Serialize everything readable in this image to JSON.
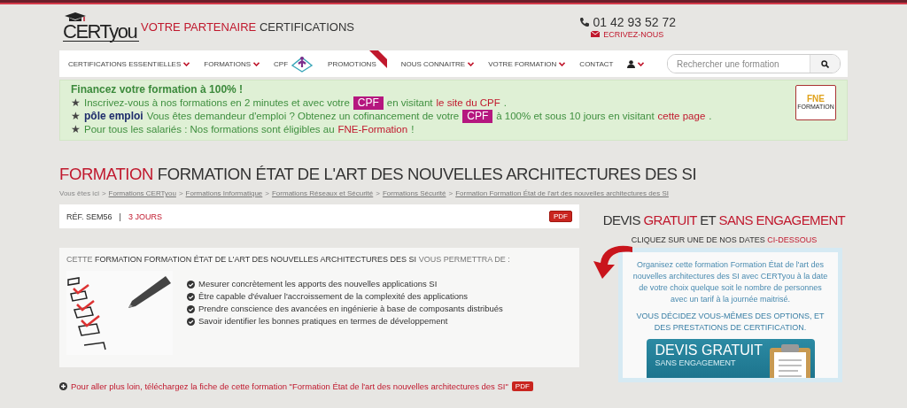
{
  "header": {
    "logo": "CERTyou",
    "tagline": [
      {
        "text": "VOTRE PARTENAIRE",
        "accent": true
      },
      {
        "text": " CERTIFICATIONS",
        "accent": false
      }
    ],
    "phone": "01 42 93 52 72",
    "contact_link": "ECRIVEZ-NOUS"
  },
  "nav": {
    "items": [
      {
        "kind": "text",
        "label": "CERTIFICATIONS ESSENTIELLES",
        "dropdown": true
      },
      {
        "kind": "text",
        "label": "FORMATIONS",
        "dropdown": true
      },
      {
        "kind": "cpf",
        "label": "CPF",
        "dropdown": false
      },
      {
        "kind": "promo",
        "label": "PROMOTIONS",
        "dropdown": false
      },
      {
        "kind": "text",
        "label": "NOUS CONNAITRE",
        "dropdown": true
      },
      {
        "kind": "text",
        "label": "VOTRE FORMATION",
        "dropdown": true
      },
      {
        "kind": "text",
        "label": "CONTACT",
        "dropdown": false
      },
      {
        "kind": "user",
        "dropdown": true
      }
    ],
    "search": {
      "placeholder": "Rechercher une formation"
    }
  },
  "banner": {
    "heading": "Financez votre formation à 100% !",
    "lines": [
      {
        "bullet": "★",
        "segments": [
          {
            "kind": "text",
            "text": "Inscrivez-vous à nos formations en 2 minutes et avec votre"
          },
          {
            "kind": "badge",
            "text": "CPF"
          },
          {
            "kind": "text",
            "text": "en visitant"
          },
          {
            "kind": "link",
            "text": "le site du CPF"
          },
          {
            "kind": "text",
            "text": "."
          }
        ]
      },
      {
        "bullet": "★",
        "segments": [
          {
            "kind": "logo",
            "text": "pôle emploi"
          },
          {
            "kind": "text",
            "text": "Vous êtes demandeur d'emploi ? Obtenez un cofinancement de votre"
          },
          {
            "kind": "badge",
            "text": "CPF"
          },
          {
            "kind": "text",
            "text": "à 100% et sous 10 jours en visitant"
          },
          {
            "kind": "link",
            "text": "cette page"
          },
          {
            "kind": "text",
            "text": "."
          }
        ]
      },
      {
        "bullet": "★",
        "segments": [
          {
            "kind": "text",
            "text": "Pour tous les salariés : Nos formations sont éligibles au"
          },
          {
            "kind": "link",
            "text": "FNE-Formation"
          },
          {
            "kind": "text",
            "text": "!"
          }
        ]
      }
    ],
    "fne_logo": {
      "title": "FNE",
      "subtitle": "FORMATION"
    }
  },
  "page": {
    "title": [
      {
        "text": "FORMATION",
        "accent": true
      },
      {
        "text": " FORMATION ÉTAT DE L'ART DES NOUVELLES ARCHITECTURES DES SI",
        "accent": false
      }
    ],
    "breadcrumb": {
      "prefix": "Vous êtes ici",
      "separator": ">",
      "items": [
        "Formations CERTyou",
        "Formations Informatique",
        "Formations Réseaux et Sécurité",
        "Formations Sécurité",
        "Formation Formation État de l'art des nouvelles architectures des SI"
      ]
    }
  },
  "course": {
    "reference": "RÉF. SEM56",
    "separator": "|",
    "duration": "3 JOURS",
    "pdf": "PDF",
    "intro": [
      {
        "text": "CETTE ",
        "strong": false
      },
      {
        "text": "FORMATION FORMATION ÉTAT DE L'ART DES NOUVELLES ARCHITECTURES DES SI",
        "strong": true
      },
      {
        "text": " VOUS PERMETTRA DE :",
        "strong": false
      }
    ],
    "objectives": [
      "Mesurer concrètement les apports des nouvelles applications SI",
      "Être capable d'évaluer l'accroissement de la complexité des applications",
      "Prendre conscience des avancées en ingénierie à base de composants distribués",
      "Savoir identifier les bonnes pratiques en termes de développement"
    ],
    "download": {
      "text": "Pour aller plus loin, téléchargez la fiche de cette formation \"Formation État de l'art des nouvelles architectures des SI\"",
      "pdf": "PDF"
    }
  },
  "quote": {
    "title": [
      {
        "text": "DEVIS ",
        "accent": false
      },
      {
        "text": "GRATUIT",
        "accent": true
      },
      {
        "text": " ET ",
        "accent": false
      },
      {
        "text": "SANS ENGAGEMENT",
        "accent": true
      }
    ],
    "subtitle": [
      {
        "text": "CLIQUEZ SUR UNE DE NOS DATES ",
        "accent": false
      },
      {
        "text": "CI-DESSOUS",
        "accent": true
      }
    ],
    "description": "Organisez cette formation Formation État de l'art des nouvelles architectures des SI avec CERTyou à la date de votre choix quelque soit le nombre de personnes avec un tarif à la journée maitrisé.",
    "note": "VOUS DÉCIDEZ VOUS-MÊMES DES OPTIONS, ET DES PRESTATIONS DE CERTIFICATION.",
    "cta": {
      "title": "DEVIS GRATUIT",
      "subtitle": "SANS ENGAGEMENT"
    }
  }
}
